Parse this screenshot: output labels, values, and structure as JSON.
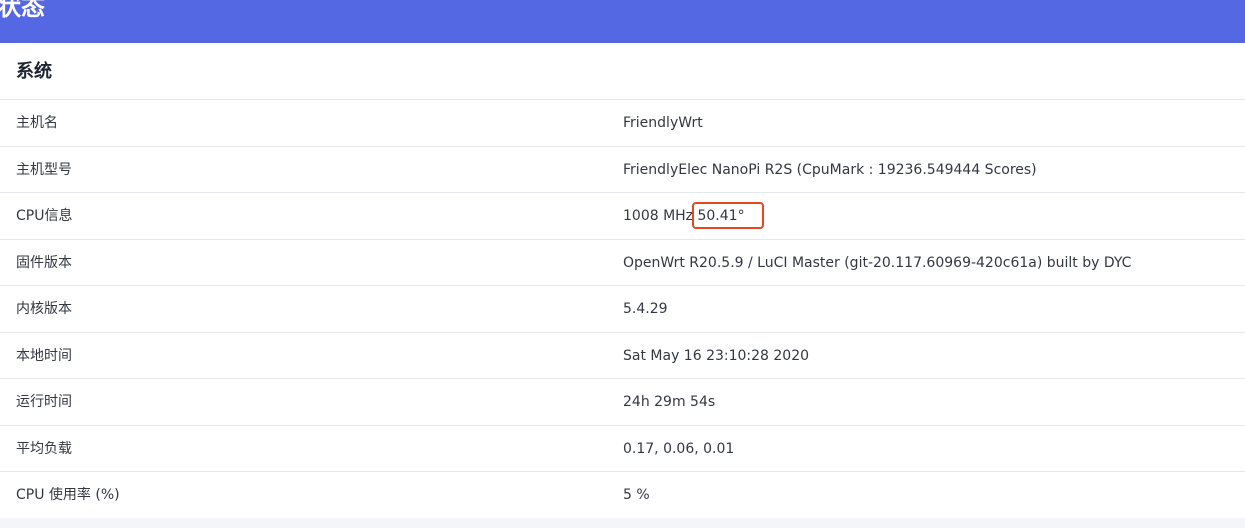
{
  "header": {
    "title": "状态"
  },
  "system": {
    "section_title": "系统",
    "rows": [
      {
        "label": "主机名",
        "value": "FriendlyWrt"
      },
      {
        "label": "主机型号",
        "value": "FriendlyElec NanoPi R2S (CpuMark : 19236.549444 Scores)"
      },
      {
        "label": "CPU信息",
        "value_prefix": "1008 MHz ",
        "value_temp": "50.41°"
      },
      {
        "label": "固件版本",
        "value": "OpenWrt R20.5.9 / LuCI Master (git-20.117.60969-420c61a) built by DYC"
      },
      {
        "label": "内核版本",
        "value": "5.4.29"
      },
      {
        "label": "本地时间",
        "value": "Sat May 16 23:10:28 2020"
      },
      {
        "label": "运行时间",
        "value": "24h 29m 54s"
      },
      {
        "label": "平均负载",
        "value": "0.17, 0.06, 0.01"
      },
      {
        "label": "CPU 使用率 (%)",
        "value": "5 %"
      }
    ]
  },
  "colors": {
    "header_bg": "#5468e3",
    "highlight_border": "#e4481f"
  }
}
